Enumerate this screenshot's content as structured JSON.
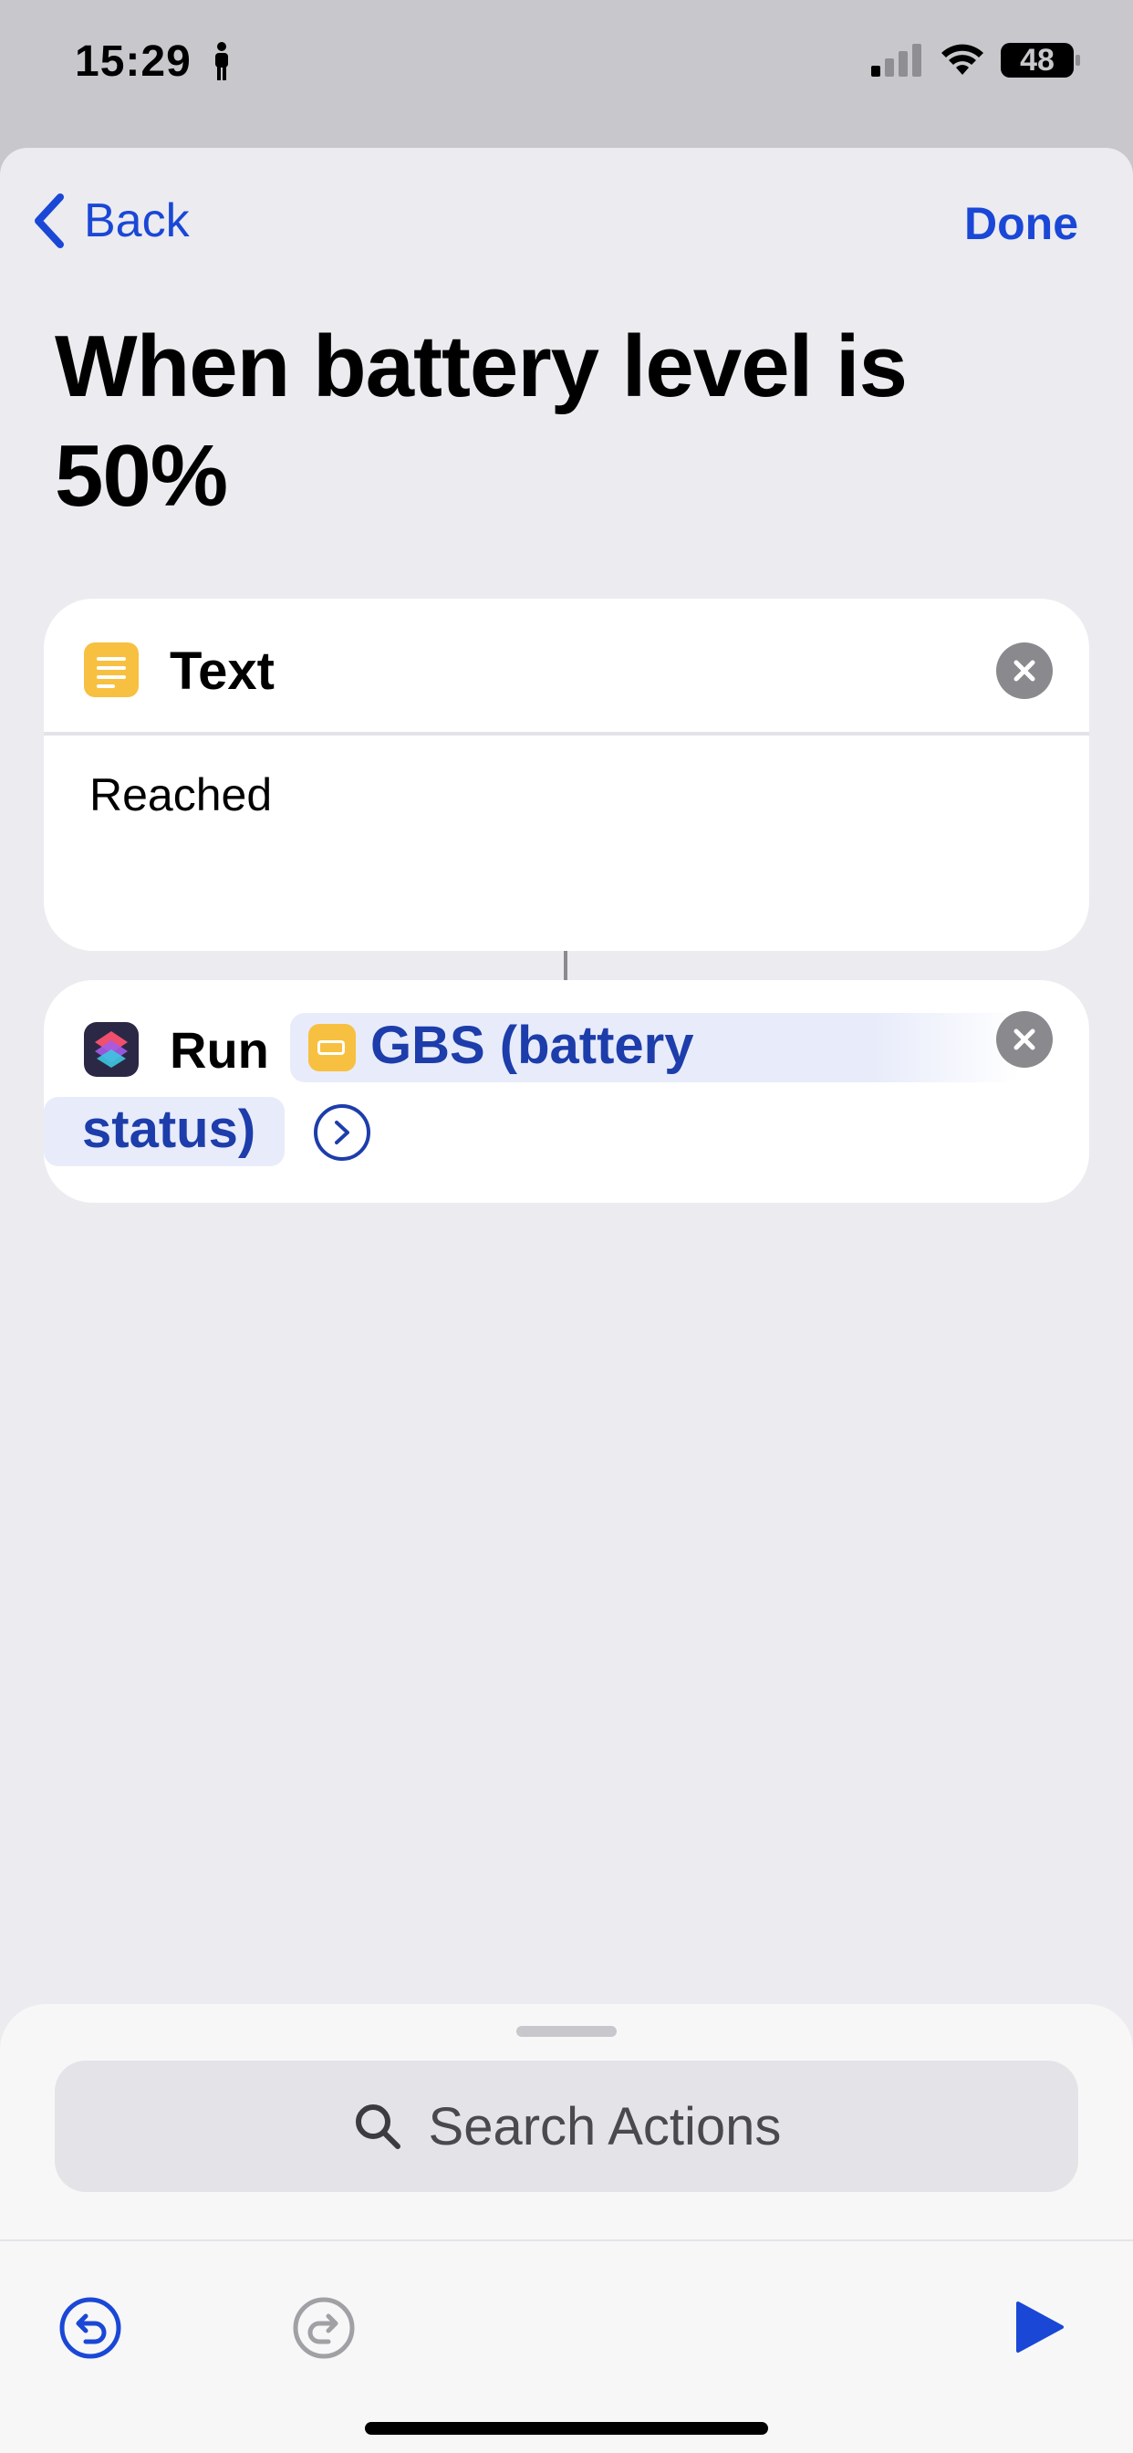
{
  "status_bar": {
    "time": "15:29",
    "battery_level": "48",
    "icons": [
      "person-icon",
      "signal-icon",
      "wifi-icon",
      "battery-icon"
    ]
  },
  "nav": {
    "back_label": "Back",
    "done_label": "Done"
  },
  "title": "When battery level is 50%",
  "actions": [
    {
      "type": "Text",
      "icon": "text-action-icon",
      "value": "Reached"
    },
    {
      "type": "Run",
      "icon": "shortcuts-icon",
      "token_line1": "GBS (battery",
      "token_line2": "status)",
      "token_icon": "battery-icon"
    }
  ],
  "bottom_panel": {
    "search_placeholder": "Search Actions"
  },
  "colors": {
    "accent": "#1a47d6",
    "token_text": "#1d3dab",
    "text_icon_bg": "#f7c041",
    "sheet_bg": "#ebebf0"
  }
}
